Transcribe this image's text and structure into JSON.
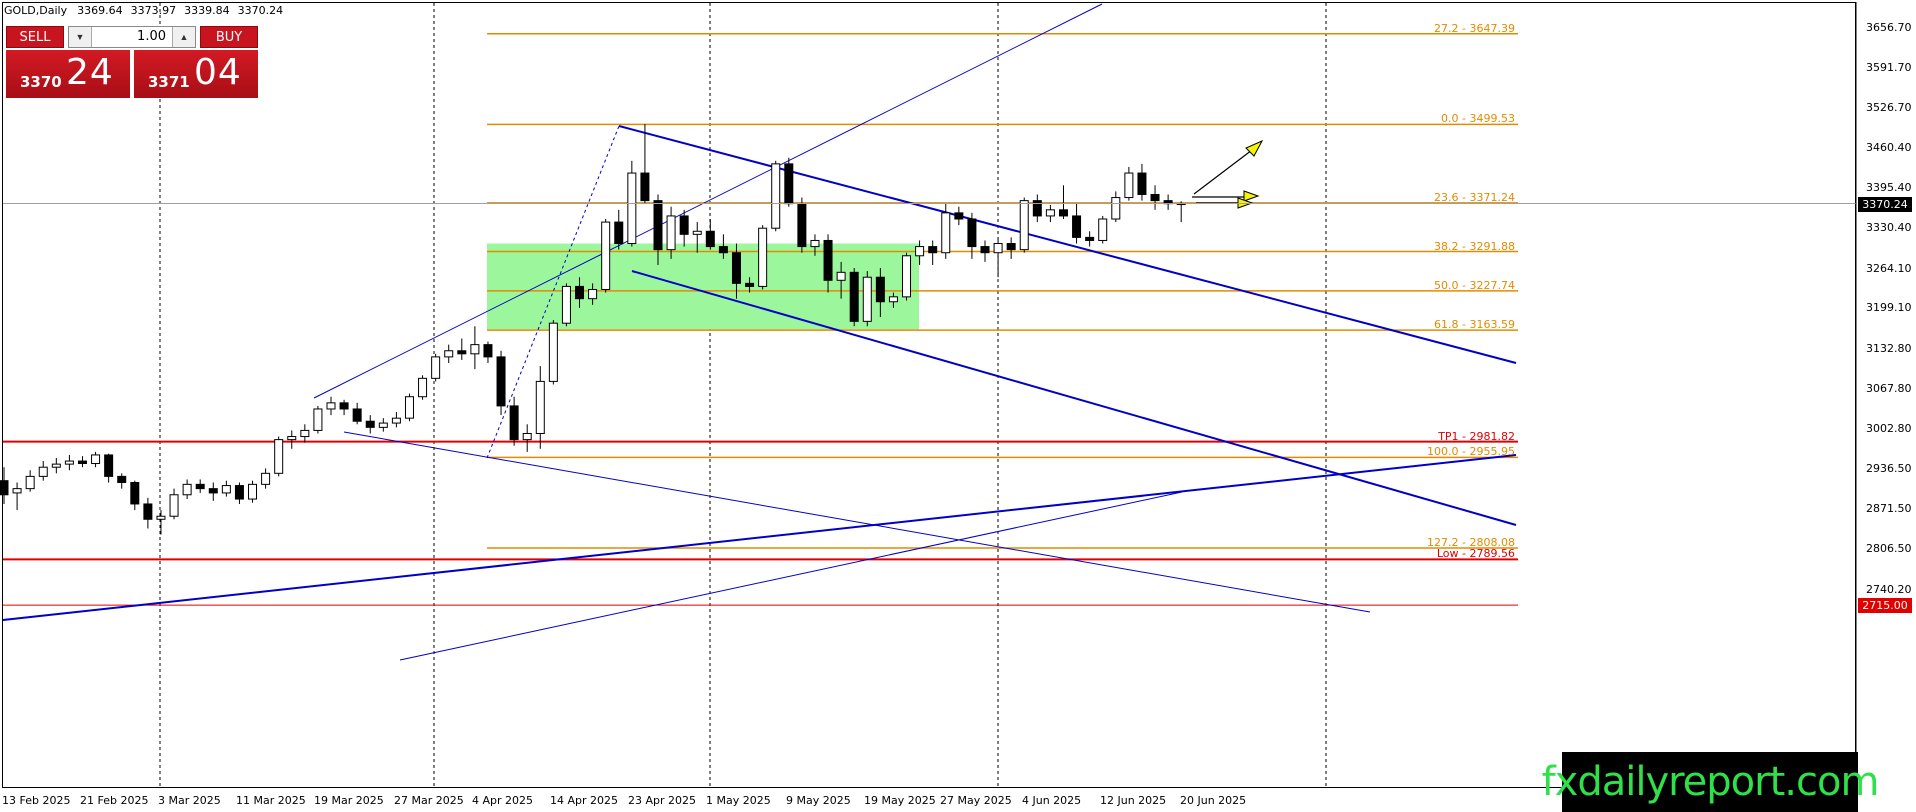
{
  "header": {
    "symbol": "GOLD,Daily",
    "open": "3369.64",
    "high": "3373.97",
    "low": "3339.84",
    "close": "3370.24"
  },
  "trade_panel": {
    "sell_label": "SELL",
    "buy_label": "BUY",
    "lot_value": "1.00",
    "bid_small": "3370",
    "bid_big": "24",
    "ask_small": "3371",
    "ask_big": "04"
  },
  "watermark": "fxdailyreport.com",
  "colors": {
    "fib": "#e38b00",
    "channel": "#0000c8",
    "red_level": "#e00000",
    "zone": "#9cf79c",
    "bull": "#ffffff",
    "bear": "#000000"
  },
  "chart_data": {
    "type": "candlestick",
    "symbol": "GOLD",
    "timeframe": "Daily",
    "ylim": [
      2690,
      3720
    ],
    "y_ticks": [
      "3656.70",
      "3591.70",
      "3526.70",
      "3460.40",
      "3395.40",
      "3330.40",
      "3264.10",
      "3199.10",
      "3132.80",
      "3067.80",
      "3002.80",
      "2936.50",
      "2871.50",
      "2806.50",
      "2740.20"
    ],
    "current_price": "3370.24",
    "red_price_label": "2715.00",
    "x_ticks": [
      "13 Feb 2025",
      "21 Feb 2025",
      "3 Mar 2025",
      "11 Mar 2025",
      "19 Mar 2025",
      "27 Mar 2025",
      "4 Apr 2025",
      "14 Apr 2025",
      "23 Apr 2025",
      "1 May 2025",
      "9 May 2025",
      "19 May 2025",
      "27 May 2025",
      "4 Jun 2025",
      "12 Jun 2025",
      "20 Jun 2025"
    ],
    "fib_levels": [
      {
        "label": "27.2 - 3647.39",
        "price": 3647.39
      },
      {
        "label": "0.0 - 3499.53",
        "price": 3499.53
      },
      {
        "label": "23.6 - 3371.24",
        "price": 3371.24
      },
      {
        "label": "38.2 - 3291.88",
        "price": 3291.88
      },
      {
        "label": "50.0 - 3227.74",
        "price": 3227.74
      },
      {
        "label": "61.8 - 3163.59",
        "price": 3163.59
      },
      {
        "label": "100.0 - 2955.95",
        "price": 2955.95
      },
      {
        "label": "127.2 - 2808.08",
        "price": 2808.08
      }
    ],
    "red_levels": [
      {
        "label": "TP1 - 2981.82",
        "price": 2981.82
      },
      {
        "label": "Low - 2789.56",
        "price": 2789.56
      },
      {
        "label": "",
        "price": 2715.0
      }
    ],
    "zone": {
      "top": 3305,
      "bottom": 3165
    },
    "candles": [
      [
        2918,
        2940,
        2880,
        2895
      ],
      [
        2898,
        2915,
        2870,
        2905
      ],
      [
        2905,
        2935,
        2900,
        2925
      ],
      [
        2925,
        2950,
        2918,
        2940
      ],
      [
        2940,
        2955,
        2930,
        2945
      ],
      [
        2945,
        2960,
        2935,
        2950
      ],
      [
        2950,
        2958,
        2940,
        2946
      ],
      [
        2946,
        2965,
        2940,
        2960
      ],
      [
        2960,
        2962,
        2915,
        2925
      ],
      [
        2925,
        2930,
        2905,
        2915
      ],
      [
        2915,
        2918,
        2870,
        2880
      ],
      [
        2880,
        2890,
        2840,
        2855
      ],
      [
        2855,
        2870,
        2830,
        2860
      ],
      [
        2860,
        2905,
        2855,
        2895
      ],
      [
        2895,
        2920,
        2888,
        2912
      ],
      [
        2912,
        2920,
        2898,
        2905
      ],
      [
        2905,
        2915,
        2885,
        2898
      ],
      [
        2898,
        2918,
        2892,
        2910
      ],
      [
        2910,
        2915,
        2880,
        2888
      ],
      [
        2888,
        2918,
        2882,
        2912
      ],
      [
        2912,
        2938,
        2905,
        2930
      ],
      [
        2930,
        2990,
        2925,
        2985
      ],
      [
        2985,
        3000,
        2970,
        2990
      ],
      [
        2990,
        3010,
        2980,
        3000
      ],
      [
        3000,
        3040,
        2995,
        3035
      ],
      [
        3035,
        3055,
        3025,
        3045
      ],
      [
        3045,
        3050,
        3025,
        3035
      ],
      [
        3035,
        3045,
        3010,
        3015
      ],
      [
        3015,
        3025,
        2995,
        3005
      ],
      [
        3005,
        3020,
        2998,
        3012
      ],
      [
        3012,
        3030,
        3005,
        3020
      ],
      [
        3020,
        3060,
        3015,
        3055
      ],
      [
        3055,
        3090,
        3050,
        3085
      ],
      [
        3085,
        3125,
        3080,
        3120
      ],
      [
        3120,
        3140,
        3110,
        3130
      ],
      [
        3130,
        3150,
        3115,
        3125
      ],
      [
        3125,
        3170,
        3100,
        3140
      ],
      [
        3140,
        3145,
        3110,
        3120
      ],
      [
        3120,
        3130,
        3025,
        3040
      ],
      [
        3040,
        3055,
        2975,
        2985
      ],
      [
        2985,
        3010,
        2965,
        2995
      ],
      [
        2995,
        3105,
        2970,
        3080
      ],
      [
        3080,
        3180,
        3075,
        3175
      ],
      [
        3175,
        3240,
        3170,
        3235
      ],
      [
        3235,
        3250,
        3200,
        3215
      ],
      [
        3215,
        3240,
        3205,
        3230
      ],
      [
        3230,
        3345,
        3225,
        3340
      ],
      [
        3340,
        3360,
        3295,
        3305
      ],
      [
        3305,
        3440,
        3300,
        3420
      ],
      [
        3420,
        3500,
        3370,
        3375
      ],
      [
        3375,
        3385,
        3270,
        3295
      ],
      [
        3295,
        3365,
        3280,
        3350
      ],
      [
        3350,
        3360,
        3300,
        3320
      ],
      [
        3320,
        3340,
        3290,
        3325
      ],
      [
        3325,
        3345,
        3295,
        3300
      ],
      [
        3300,
        3320,
        3280,
        3290
      ],
      [
        3290,
        3305,
        3215,
        3240
      ],
      [
        3240,
        3250,
        3225,
        3235
      ],
      [
        3235,
        3335,
        3230,
        3330
      ],
      [
        3330,
        3440,
        3325,
        3435
      ],
      [
        3435,
        3445,
        3365,
        3370
      ],
      [
        3370,
        3380,
        3290,
        3300
      ],
      [
        3300,
        3320,
        3285,
        3310
      ],
      [
        3310,
        3320,
        3225,
        3245
      ],
      [
        3245,
        3275,
        3215,
        3258
      ],
      [
        3258,
        3265,
        3170,
        3178
      ],
      [
        3178,
        3260,
        3170,
        3250
      ],
      [
        3250,
        3265,
        3185,
        3210
      ],
      [
        3210,
        3225,
        3200,
        3218
      ],
      [
        3218,
        3290,
        3212,
        3285
      ],
      [
        3285,
        3310,
        3270,
        3300
      ],
      [
        3300,
        3310,
        3270,
        3290
      ],
      [
        3290,
        3370,
        3280,
        3355
      ],
      [
        3355,
        3365,
        3335,
        3345
      ],
      [
        3345,
        3355,
        3280,
        3300
      ],
      [
        3300,
        3310,
        3275,
        3290
      ],
      [
        3290,
        3315,
        3250,
        3305
      ],
      [
        3305,
        3315,
        3280,
        3295
      ],
      [
        3295,
        3380,
        3290,
        3375
      ],
      [
        3375,
        3385,
        3340,
        3350
      ],
      [
        3350,
        3368,
        3340,
        3360
      ],
      [
        3360,
        3400,
        3345,
        3350
      ],
      [
        3350,
        3370,
        3305,
        3315
      ],
      [
        3315,
        3325,
        3300,
        3310
      ],
      [
        3310,
        3350,
        3305,
        3345
      ],
      [
        3345,
        3390,
        3340,
        3380
      ],
      [
        3380,
        3430,
        3375,
        3420
      ],
      [
        3420,
        3435,
        3375,
        3385
      ],
      [
        3385,
        3400,
        3360,
        3375
      ],
      [
        3375,
        3385,
        3360,
        3370
      ],
      [
        3369.64,
        3373.97,
        3339.84,
        3370.24
      ]
    ],
    "annotations": [
      "fibonacci retracement",
      "descending channel",
      "ascending trendlines",
      "green demand zone",
      "yellow direction arrows"
    ]
  }
}
